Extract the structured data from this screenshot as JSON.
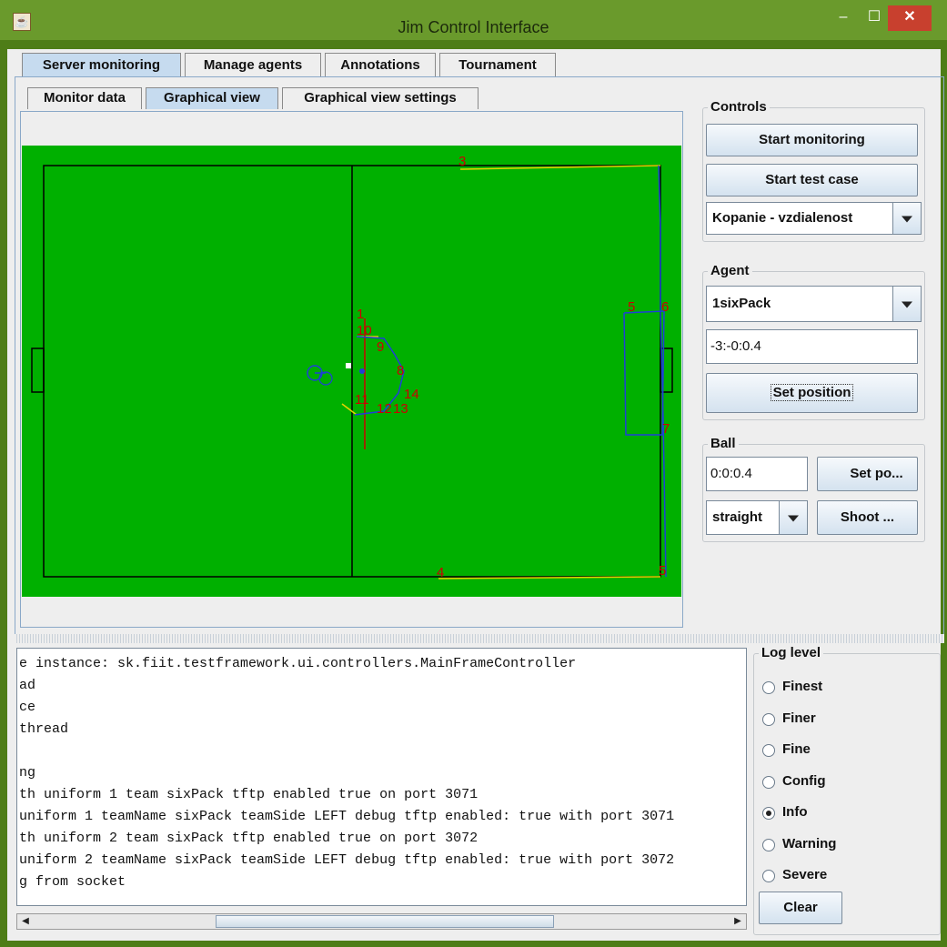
{
  "window": {
    "title": "Jim Control Interface",
    "app_icon": "java-icon",
    "minimize_glyph": "–",
    "maximize_glyph": "☐",
    "close_glyph": "✕"
  },
  "tabs": [
    "Server monitoring",
    "Manage agents",
    "Annotations",
    "Tournament"
  ],
  "sub_tabs": [
    "Monitor data",
    "Graphical view",
    "Graphical view settings"
  ],
  "controls": {
    "title": "Controls",
    "start_monitoring": "Start monitoring",
    "start_test_case": "Start test case",
    "test_case_selected": "Kopanie - vzdialenost"
  },
  "agent": {
    "title": "Agent",
    "selected": "1sixPack",
    "position_value": "-3:-0:0.4",
    "set_position": "Set position"
  },
  "ball": {
    "title": "Ball",
    "position_value": "0:0:0.4",
    "set_position": "Set po...",
    "shot_type": "straight",
    "shoot": "Shoot ..."
  },
  "field": {
    "labels": [
      "1",
      "3",
      "4",
      "5",
      "6",
      "7",
      "8",
      "9",
      "10",
      "11",
      "12",
      "13",
      "14",
      "5"
    ],
    "colors": {
      "grass": "#00b000",
      "lines": "#000000",
      "label": "#cc0000",
      "path": "#1f3fd8"
    }
  },
  "log": {
    "lines": [
      "e instance: sk.fiit.testframework.ui.controllers.MainFrameController",
      "ad",
      "ce",
      "thread",
      "",
      "ng",
      "th uniform 1 team sixPack tftp enabled true on port 3071",
      "uniform 1 teamName sixPack teamSide LEFT debug tftp enabled: true with port 3071",
      "th uniform 2 team sixPack tftp enabled true on port 3072",
      "uniform 2 teamName sixPack teamSide LEFT debug tftp enabled: true with port 3072",
      "g from socket"
    ]
  },
  "log_level": {
    "title": "Log level",
    "options": [
      "Finest",
      "Finer",
      "Fine",
      "Config",
      "Info",
      "Warning",
      "Severe"
    ],
    "selected": "Info",
    "clear": "Clear"
  }
}
